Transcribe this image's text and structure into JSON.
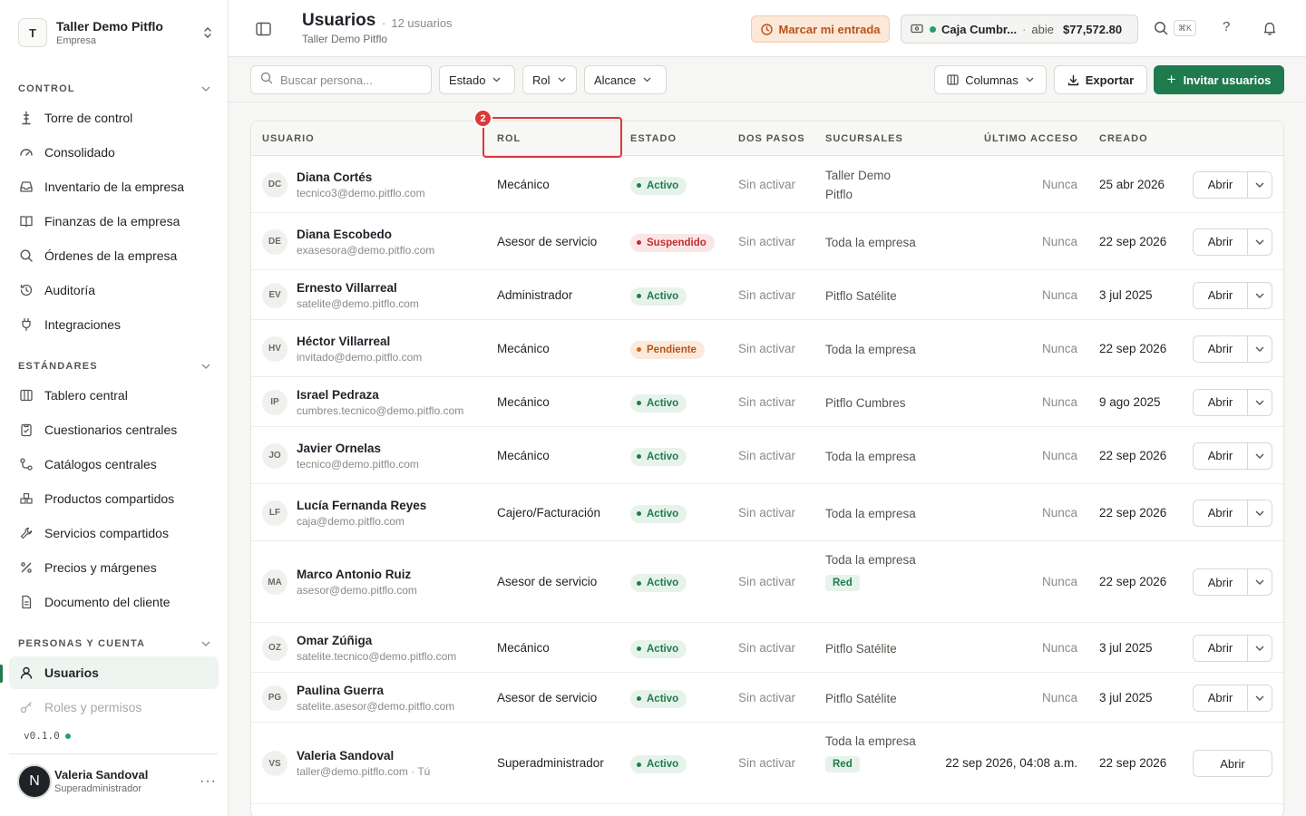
{
  "org": {
    "initial": "T",
    "name": "Taller Demo Pitflo",
    "type": "Empresa"
  },
  "sidebar": {
    "sections": [
      {
        "title": "CONTROL",
        "items": [
          "Torre de control",
          "Consolidado",
          "Inventario de la empresa",
          "Finanzas de la empresa",
          "Órdenes de la empresa",
          "Auditoría",
          "Integraciones"
        ]
      },
      {
        "title": "ESTÁNDARES",
        "items": [
          "Tablero central",
          "Cuestionarios centrales",
          "Catálogos centrales",
          "Productos compartidos",
          "Servicios compartidos",
          "Precios y márgenes",
          "Documento del cliente"
        ]
      },
      {
        "title": "PERSONAS Y CUENTA",
        "items": [
          "Usuarios",
          "Roles y permisos"
        ]
      }
    ],
    "version": "v0.1.0",
    "user": {
      "initial": "N",
      "name": "Valeria Sandoval",
      "role": "Superadministrador",
      "more": "···"
    }
  },
  "header": {
    "title": "Usuarios",
    "count": "12 usuarios",
    "subtitle": "Taller Demo Pitflo",
    "clock_in": "Marcar mi entrada",
    "till": {
      "name": "Caja Cumbr...",
      "sep": "·",
      "status": "abie",
      "amount": "$77,572.80"
    },
    "kbd": "⌘K",
    "help": "?"
  },
  "toolbar": {
    "search_placeholder": "Buscar persona...",
    "filters": [
      "Estado",
      "Rol",
      "Alcance"
    ],
    "columns": "Columnas",
    "export": "Exportar",
    "invite": "Invitar usuarios"
  },
  "table": {
    "headers": [
      "USUARIO",
      "ROL",
      "ESTADO",
      "DOS PASOS",
      "SUCURSALES",
      "ÚLTIMO ACCESO",
      "CREADO"
    ],
    "highlight_badge": "2",
    "open_label": "Abrir",
    "rows": [
      {
        "initials": "DC",
        "name": "Diana Cortés",
        "email": "tecnico3@demo.pitflo.com",
        "role": "Mecánico",
        "status": "Activo",
        "twofa": "Sin activar",
        "branch": "Taller Demo Pitflo",
        "tag": "",
        "access": "Nunca",
        "created": "25 abr 2026"
      },
      {
        "initials": "DE",
        "name": "Diana Escobedo",
        "email": "exasesora@demo.pitflo.com",
        "role": "Asesor de servicio",
        "status": "Suspendido",
        "twofa": "Sin activar",
        "branch": "Toda la empresa",
        "tag": "",
        "access": "Nunca",
        "created": "22 sep 2026"
      },
      {
        "initials": "EV",
        "name": "Ernesto Villarreal",
        "email": "satelite@demo.pitflo.com",
        "role": "Administrador",
        "status": "Activo",
        "twofa": "Sin activar",
        "branch": "Pitflo Satélite",
        "tag": "",
        "access": "Nunca",
        "created": "3 jul 2025"
      },
      {
        "initials": "HV",
        "name": "Héctor Villarreal",
        "email": "invitado@demo.pitflo.com",
        "role": "Mecánico",
        "status": "Pendiente",
        "twofa": "Sin activar",
        "branch": "Toda la empresa",
        "tag": "",
        "access": "Nunca",
        "created": "22 sep 2026"
      },
      {
        "initials": "IP",
        "name": "Israel Pedraza",
        "email": "cumbres.tecnico@demo.pitflo.com",
        "role": "Mecánico",
        "status": "Activo",
        "twofa": "Sin activar",
        "branch": "Pitflo Cumbres",
        "tag": "",
        "access": "Nunca",
        "created": "9 ago 2025"
      },
      {
        "initials": "JO",
        "name": "Javier Ornelas",
        "email": "tecnico@demo.pitflo.com",
        "role": "Mecánico",
        "status": "Activo",
        "twofa": "Sin activar",
        "branch": "Toda la empresa",
        "tag": "",
        "access": "Nunca",
        "created": "22 sep 2026"
      },
      {
        "initials": "LF",
        "name": "Lucía Fernanda Reyes",
        "email": "caja@demo.pitflo.com",
        "role": "Cajero/Facturación",
        "status": "Activo",
        "twofa": "Sin activar",
        "branch": "Toda la empresa",
        "tag": "",
        "access": "Nunca",
        "created": "22 sep 2026"
      },
      {
        "initials": "MA",
        "name": "Marco Antonio Ruiz",
        "email": "asesor@demo.pitflo.com",
        "role": "Asesor de servicio",
        "status": "Activo",
        "twofa": "Sin activar",
        "branch": "Toda la empresa",
        "tag": "Red",
        "access": "Nunca",
        "created": "22 sep 2026"
      },
      {
        "initials": "OZ",
        "name": "Omar Zúñiga",
        "email": "satelite.tecnico@demo.pitflo.com",
        "role": "Mecánico",
        "status": "Activo",
        "twofa": "Sin activar",
        "branch": "Pitflo Satélite",
        "tag": "",
        "access": "Nunca",
        "created": "3 jul 2025"
      },
      {
        "initials": "PG",
        "name": "Paulina Guerra",
        "email": "satelite.asesor@demo.pitflo.com",
        "role": "Asesor de servicio",
        "status": "Activo",
        "twofa": "Sin activar",
        "branch": "Pitflo Satélite",
        "tag": "",
        "access": "Nunca",
        "created": "3 jul 2025"
      },
      {
        "initials": "VS",
        "name": "Valeria Sandoval",
        "email": "taller@demo.pitflo.com · Tú",
        "role": "Superadministrador",
        "status": "Activo",
        "twofa": "Sin activar",
        "branch": "Toda la empresa",
        "tag": "Red",
        "access": "22 sep 2026, 04:08 a.m.",
        "created": "22 sep 2026"
      }
    ]
  }
}
